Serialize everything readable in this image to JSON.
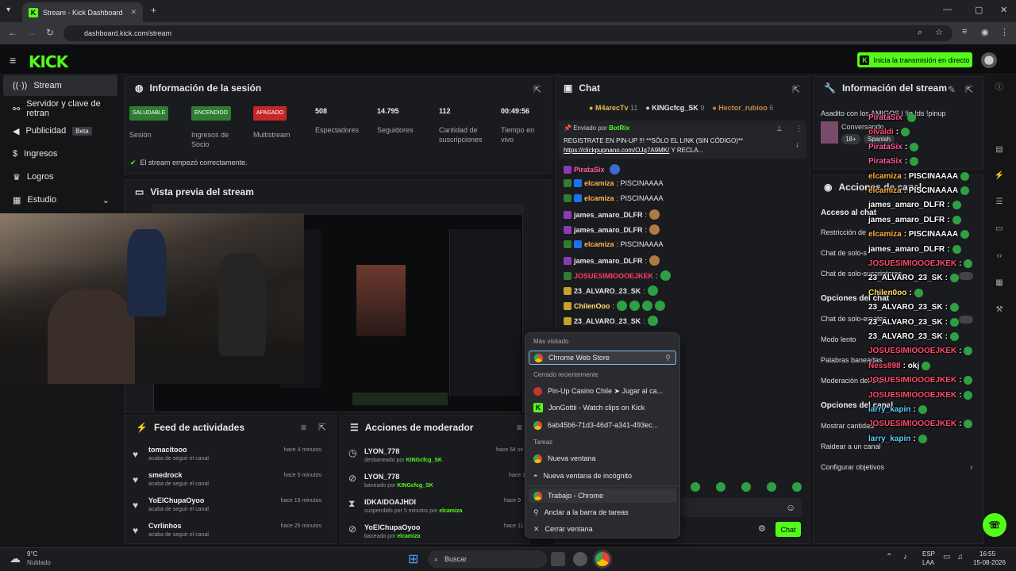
{
  "browser": {
    "tab_title": "Stream - Kick Dashboard",
    "url": "dashboard.kick.com/stream"
  },
  "topbar": {
    "logo": "KICK",
    "go_live": "Inicia la transmisión en directo"
  },
  "sidebar": {
    "items": [
      {
        "label": "Stream",
        "icon": "signal-icon"
      },
      {
        "label": "Servidor y clave de retran",
        "icon": "link-icon"
      },
      {
        "label": "Publicidad",
        "icon": "megaphone-icon",
        "badge": "Beta"
      },
      {
        "label": "Ingresos",
        "icon": "dollar-icon"
      },
      {
        "label": "Logros",
        "icon": "trophy-icon"
      },
      {
        "label": "Estudio",
        "icon": "grid-icon"
      }
    ]
  },
  "session": {
    "title": "Información de la sesión",
    "stats": [
      {
        "badge": "SALUDABLE",
        "label": "Sesión"
      },
      {
        "badge": "ENCENDIDO",
        "label": "Ingresos de Socio"
      },
      {
        "badge": "APAGADO",
        "label": "Multistream"
      },
      {
        "value": "508",
        "label": "Espectadores"
      },
      {
        "value": "14.795",
        "label": "Seguidores"
      },
      {
        "value": "112",
        "label": "Cantidad de suscripciones"
      },
      {
        "value": "00:49:56",
        "label": "Tiempo en vivo"
      }
    ],
    "status": "El stream empezó correctamente."
  },
  "preview": {
    "title": "Vista previa del stream"
  },
  "feed": {
    "title": "Feed de actividades",
    "items": [
      {
        "name": "tomacitooo",
        "desc": "acaba de seguir el canal",
        "time": "hace 4 minutos"
      },
      {
        "name": "smedrock",
        "desc": "acaba de seguir el canal",
        "time": "hace 5 minutos"
      },
      {
        "name": "YoElChupaOyoo",
        "desc": "acaba de seguir el canal",
        "time": "hace 19 minutos"
      },
      {
        "name": "Cvrlinhos",
        "desc": "acaba de seguir el canal",
        "time": "hace 25 minutos"
      }
    ]
  },
  "modactions": {
    "title": "Acciones de moderador",
    "items": [
      {
        "name": "LYON_778",
        "desc": "desbaneado por",
        "by": "KINGcfcg_SK",
        "time": "hace 54 se"
      },
      {
        "name": "LYON_778",
        "desc": "baneado por",
        "by": "KINGcfcg_SK",
        "time": "hace 1"
      },
      {
        "name": "IDKAIDOAJHDI",
        "desc": "suspendido por 5 minutos por",
        "by": "elcamiza",
        "time": "hace 9"
      },
      {
        "name": "YoElChupaOyoo",
        "desc": "baneado por",
        "by": "elcamiza",
        "time": "hace 11"
      }
    ]
  },
  "chat": {
    "title": "Chat",
    "top_supporters": [
      {
        "name": "M4arecTv",
        "count": "11"
      },
      {
        "name": "KINGcfcg_SK",
        "count": "9"
      },
      {
        "name": "Hector_rubioo",
        "count": "6"
      }
    ],
    "pinned_by_label": "Enviado por",
    "pinned_by": "BotRix",
    "pinned_text": "REGISTRATE EN PIN-UP !!! **SÓLO EL LINK (SIN CÓDIGO)**",
    "pinned_link": "https://clickpupnano.com/OJq7A9MK/",
    "pinned_tail": "Y RECLA...",
    "messages": [
      {
        "user": "PirataSix",
        "text": "",
        "color": "#ff5aa0"
      },
      {
        "user": "elcamiza",
        "text": ": PISCINAAAA",
        "color": "#ffb347"
      },
      {
        "user": "elcamiza",
        "text": ": PISCINAAAA",
        "color": "#ffb347"
      },
      {
        "user": "james_amaro_DLFR",
        "text": ":",
        "color": "#e6e6e6"
      },
      {
        "user": "james_amaro_DLFR",
        "text": ":",
        "color": "#e6e6e6"
      },
      {
        "user": "elcamiza",
        "text": ": PISCINAAAA",
        "color": "#ffb347"
      },
      {
        "user": "james_amaro_DLFR",
        "text": ":",
        "color": "#e6e6e6"
      },
      {
        "user": "JOSUESIMIOOOEJKEK",
        "text": ":",
        "color": "#ff3b6b"
      },
      {
        "user": "23_ALVARO_23_SK",
        "text": ":",
        "color": "#e6e6e6"
      },
      {
        "user": "ChilenOoo",
        "text": ":",
        "color": "#ffe066"
      },
      {
        "user": "23_ALVARO_23_SK",
        "text": ":",
        "color": "#e6e6e6"
      }
    ],
    "send": "Chat"
  },
  "context_menu": {
    "most_visited": "Más visitado",
    "pinned_item": "Chrome Web Store",
    "recently_closed": "Cerrado recientemente",
    "recent": [
      "Pin-Up Casino Chile ➤ Jugar al ca...",
      "JonGottii - Watch clips on Kick",
      "6ab45b6-71d3-46d7-a341-493ec..."
    ],
    "tasks": "Tareas",
    "task_items": [
      "Nueva ventana",
      "Nueva ventana de incógnito"
    ],
    "profile": "Trabajo - Chrome",
    "pin": "Anclar a la barra de tareas",
    "close": "Cerrar ventana"
  },
  "streaminfo": {
    "title": "Información del stream",
    "stream_title": "Asadito con los AMIGOS | !ig !ds !pinup",
    "category": "Conversando",
    "tags": [
      "18+",
      "Spanish"
    ]
  },
  "channel_actions": {
    "title": "Acciones de canal",
    "chat_access": "Acceso al chat",
    "rows": [
      "Restricción de",
      "Chat de solo-s",
      "Chat de solo-suscriptores"
    ],
    "chat_options": "Opciones del chat",
    "rows2": [
      "Chat de solo-emotes",
      "Modo lento",
      "Palabras baneadas",
      "Moderación del chat"
    ],
    "channel_options": "Opciones del canal",
    "rows3": [
      "Mostrar cantidad",
      "Raidear a un canal",
      "Configurar objetivos"
    ]
  },
  "overlay_chat": [
    {
      "user": "PirataSix",
      "text": "",
      "cls": "m"
    },
    {
      "user": "olvaldi",
      "text": ":",
      "cls": "r"
    },
    {
      "user": "PirataSix",
      "text": ":",
      "cls": "m"
    },
    {
      "user": "PirataSix",
      "text": ":",
      "cls": "m"
    },
    {
      "user": "elcamiza",
      "text": ": PISCINAAAA",
      "cls": "o"
    },
    {
      "user": "elcamiza",
      "text": ": PISCINAAAA",
      "cls": "o"
    },
    {
      "user": "james_amaro_DLFR",
      "text": ":",
      "cls": "u"
    },
    {
      "user": "james_amaro_DLFR",
      "text": ":",
      "cls": "u"
    },
    {
      "user": "elcamiza",
      "text": ": PISCINAAAA",
      "cls": "o"
    },
    {
      "user": "james_amaro_DLFR",
      "text": ":",
      "cls": "u"
    },
    {
      "user": "JOSUESIMIOOOEJKEK",
      "text": ":",
      "cls": "r"
    },
    {
      "user": "23_ALVARO_23_SK",
      "text": ":",
      "cls": "u"
    },
    {
      "user": "Chilen0oo",
      "text": ":",
      "cls": "y"
    },
    {
      "user": "23_ALVARO_23_SK",
      "text": ":",
      "cls": "u"
    },
    {
      "user": "23_ALVARO_23_SK",
      "text": ":",
      "cls": "u"
    },
    {
      "user": "23_ALVARO_23_SK",
      "text": ":",
      "cls": "u"
    },
    {
      "user": "JOSUESIMIOOOEJKEK",
      "text": ":",
      "cls": "r"
    },
    {
      "user": "Ness898",
      "text": ": okj",
      "cls": "r"
    },
    {
      "user": "JOSUESIMIOOOEJKEK",
      "text": ":",
      "cls": "r"
    },
    {
      "user": "JOSUESIMIOOOEJKEK",
      "text": ":",
      "cls": "r"
    },
    {
      "user": "larry_kapin",
      "text": ":",
      "cls": "c"
    },
    {
      "user": "JOSUESIMIOOOEJKEK",
      "text": ":",
      "cls": "r"
    },
    {
      "user": "larry_kapin",
      "text": ":",
      "cls": "c"
    }
  ],
  "taskbar": {
    "weather_temp": "9°C",
    "weather_desc": "Nublado",
    "search": "Buscar",
    "lang": "ESP",
    "lang2": "LAA",
    "time": "16:55",
    "date": "15-08-2026"
  },
  "colors": {
    "accent": "#53fc18",
    "bg": "#141517",
    "panel": "#191b1f"
  }
}
